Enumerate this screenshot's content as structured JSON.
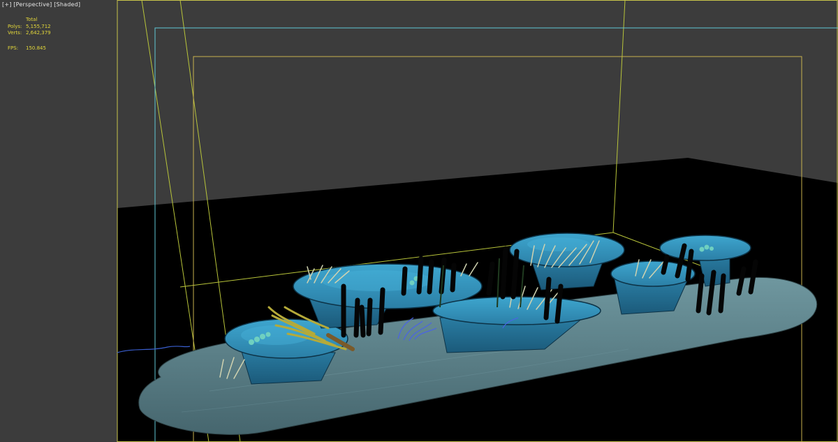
{
  "viewport": {
    "label_plus": "[+]",
    "label_view": "[Perspective]",
    "label_shading": "[Shaded]"
  },
  "stats": {
    "header": "Total",
    "polys_label": "Polys:",
    "polys_value": "5,155,712",
    "verts_label": "Verts:",
    "verts_value": "2,642,379",
    "fps_label": "FPS:",
    "fps_value": "150.845"
  },
  "colors": {
    "viewport_bg": "#3c3c3c",
    "safe_frame_outer": "#c8c44a",
    "safe_frame_action": "#5fc7d6",
    "safe_frame_title": "#c9b24e",
    "stats_text": "#e3d73a",
    "rock": "#2e8db5",
    "sand": "#5a7f88"
  }
}
